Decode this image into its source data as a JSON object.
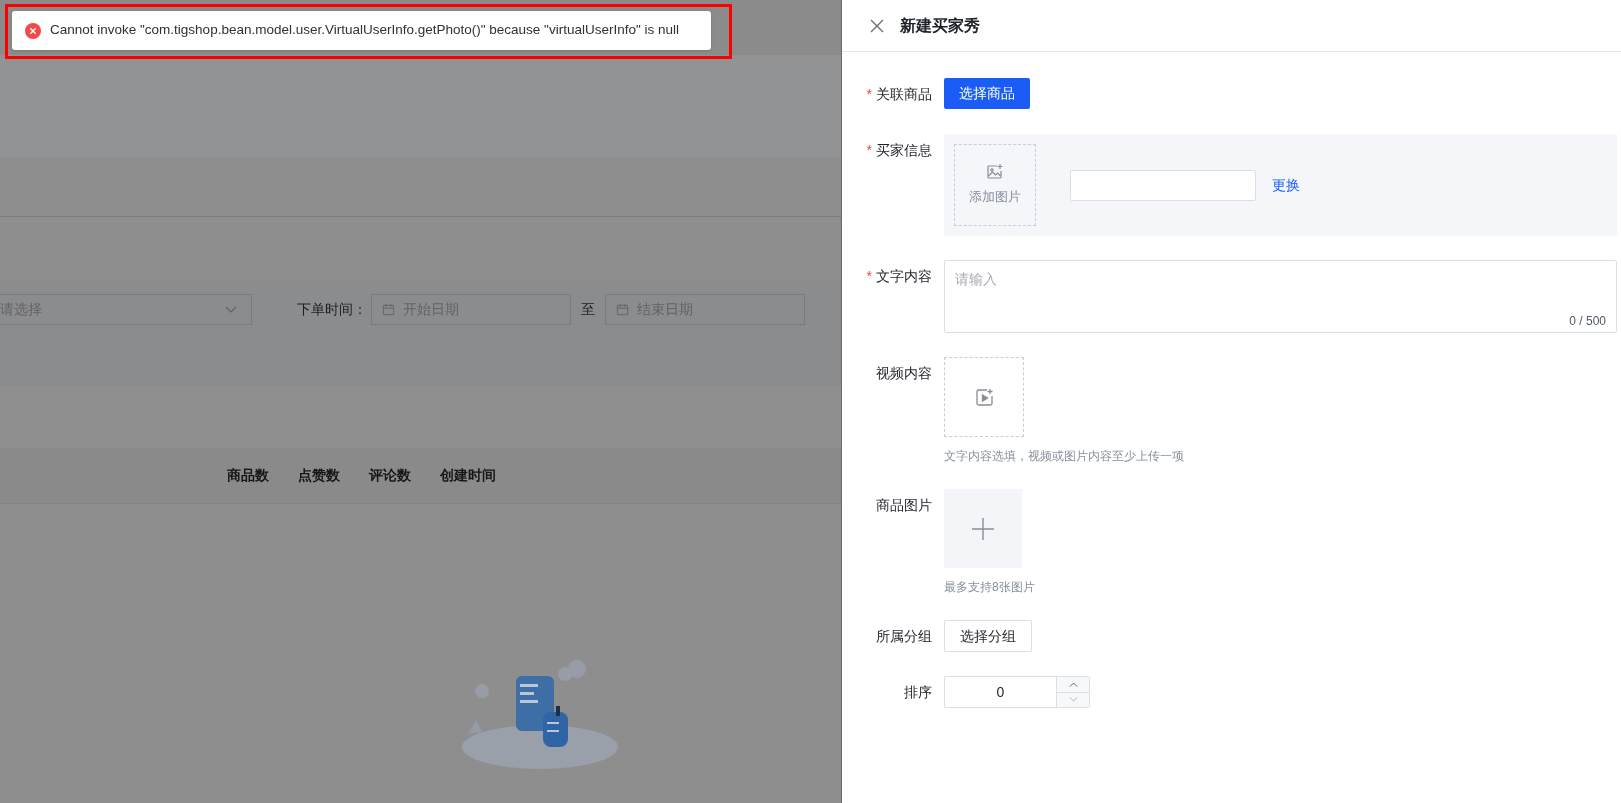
{
  "toast": {
    "message": "Cannot invoke \"com.tigshop.bean.model.user.VirtualUserInfo.getPhoto()\" because \"virtualUserInfo\" is null",
    "highlighted": true
  },
  "background_page": {
    "filters": {
      "select_placeholder": "请选择",
      "date_label": "下单时间：",
      "start_placeholder": "开始日期",
      "separator": "至",
      "end_placeholder": "结束日期"
    },
    "table": {
      "columns": [
        "商品数",
        "点赞数",
        "评论数",
        "创建时间"
      ]
    }
  },
  "drawer": {
    "title": "新建买家秀",
    "fields": [
      {
        "kind": "button",
        "label": "关联商品",
        "required_mark": "*",
        "button_label": "选择商品",
        "primary": true
      },
      {
        "kind": "buyer",
        "label": "买家信息",
        "required_mark": "*",
        "upload_label": "添加图片",
        "link": "更换"
      },
      {
        "kind": "textarea",
        "label": "文字内容",
        "required_mark": "*",
        "placeholder": "请输入",
        "counter": "0 / 500"
      },
      {
        "kind": "video",
        "label": "视频内容",
        "hint": "文字内容选填，视频或图片内容至少上传一项"
      },
      {
        "kind": "images",
        "label": "商品图片",
        "hint": "最多支持8张图片"
      },
      {
        "kind": "button",
        "label": "所属分组",
        "button_label": "选择分组",
        "primary": false
      },
      {
        "kind": "number",
        "label": "排序",
        "value": "0"
      }
    ]
  }
}
